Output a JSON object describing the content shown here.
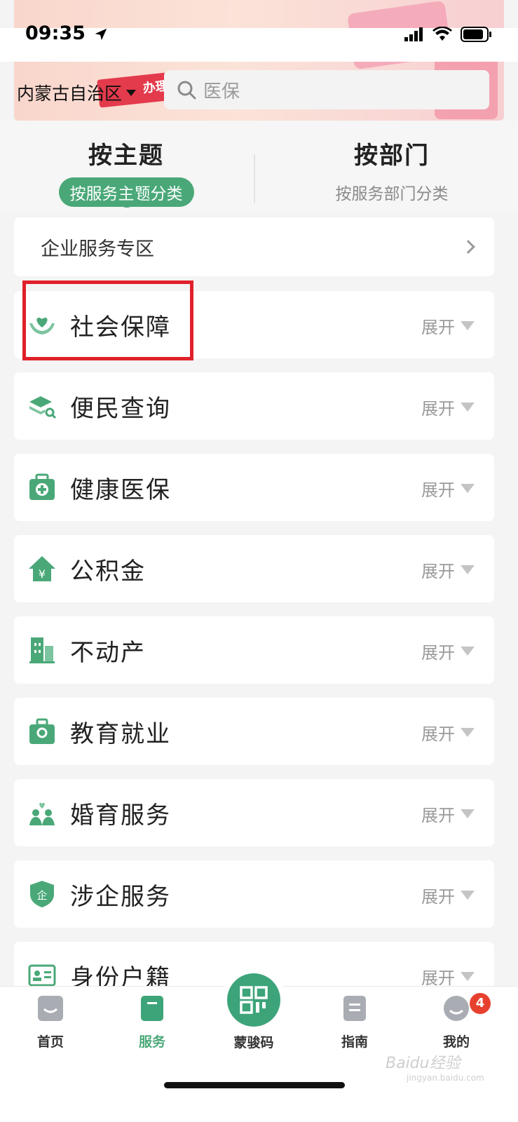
{
  "status_bar": {
    "time": "09:35"
  },
  "header": {
    "region": "内蒙古自治区",
    "banner_text": "办理",
    "search_placeholder": "医保"
  },
  "tabs": [
    {
      "title": "按主题",
      "subtitle": "按服务主题分类",
      "active": true
    },
    {
      "title": "按部门",
      "subtitle": "按服务部门分类",
      "active": false
    }
  ],
  "enterprise": {
    "label": "企业服务专区"
  },
  "expand_label": "展开",
  "categories": [
    {
      "name": "社会保障",
      "icon": "heart-hands-icon"
    },
    {
      "name": "便民查询",
      "icon": "stack-search-icon"
    },
    {
      "name": "健康医保",
      "icon": "medical-kit-icon"
    },
    {
      "name": "公积金",
      "icon": "house-yuan-icon"
    },
    {
      "name": "不动产",
      "icon": "building-icon"
    },
    {
      "name": "教育就业",
      "icon": "briefcase-icon"
    },
    {
      "name": "婚育服务",
      "icon": "family-icon"
    },
    {
      "name": "涉企服务",
      "icon": "shield-enterprise-icon"
    },
    {
      "name": "身份户籍",
      "icon": "id-card-icon"
    }
  ],
  "bottom_nav": {
    "home": "首页",
    "service": "服务",
    "code": "蒙骏码",
    "guide": "指南",
    "mine": "我的",
    "mine_badge": "4"
  },
  "watermark": {
    "brand": "Baidu经验",
    "url": "jingyan.baidu.com"
  },
  "colors": {
    "accent": "#4aa878",
    "highlight": "#e0202a",
    "badge": "#e8402f"
  }
}
